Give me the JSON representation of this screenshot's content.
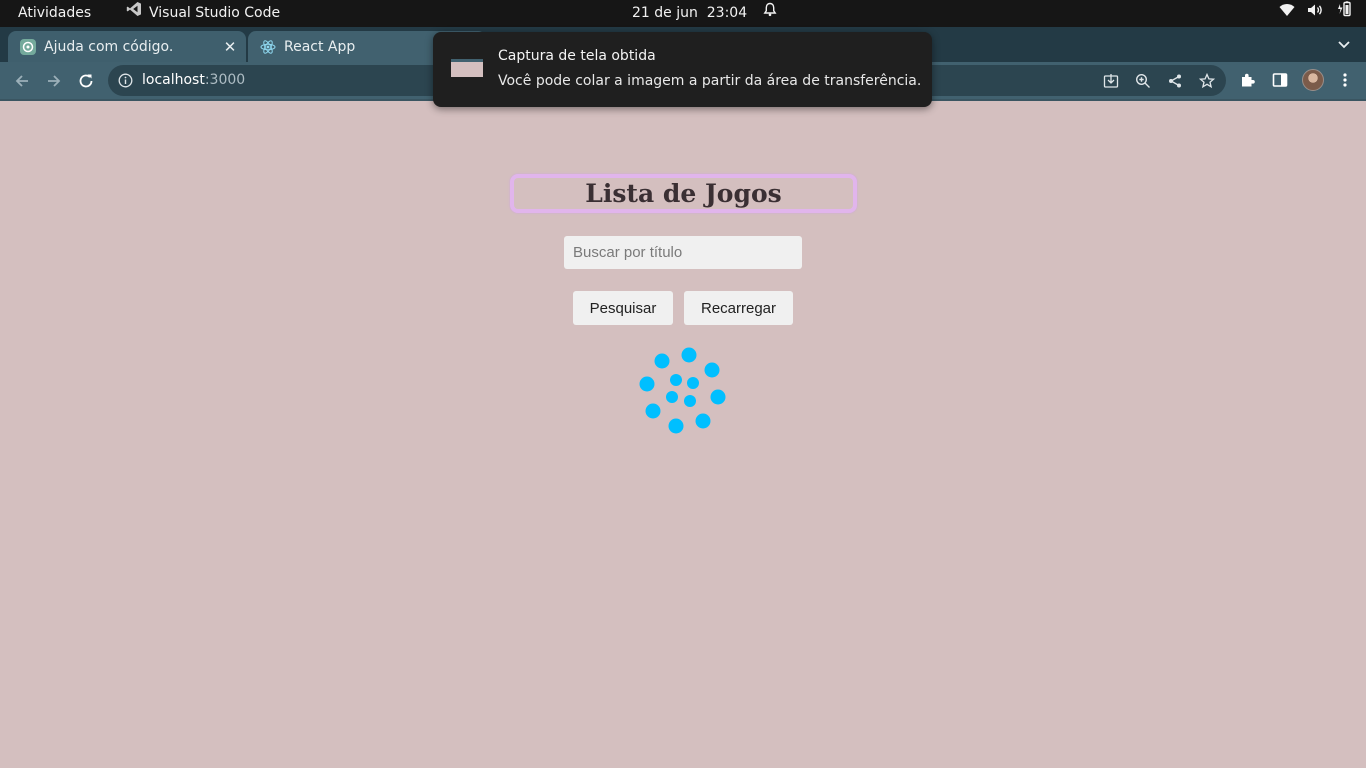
{
  "topbar": {
    "activities": "Atividades",
    "app_name": "Visual Studio Code",
    "date": "21 de jun",
    "time": "23:04"
  },
  "browser": {
    "tabs": [
      {
        "title": "Ajuda com código.",
        "icon": "chatgpt-icon",
        "active": false
      },
      {
        "title": "React App",
        "icon": "react-icon",
        "active": true
      }
    ],
    "url_host": "localhost",
    "url_port": ":3000"
  },
  "notification": {
    "title": "Captura de tela obtida",
    "body": "Você pode colar a imagem a partir da área de transferência."
  },
  "page": {
    "title": "Lista de Jogos",
    "search_placeholder": "Buscar por título",
    "search_value": "",
    "search_button": "Pesquisar",
    "reload_button": "Recarregar",
    "spinner_color": "#00bfff",
    "background_color": "#d4bfbf"
  }
}
